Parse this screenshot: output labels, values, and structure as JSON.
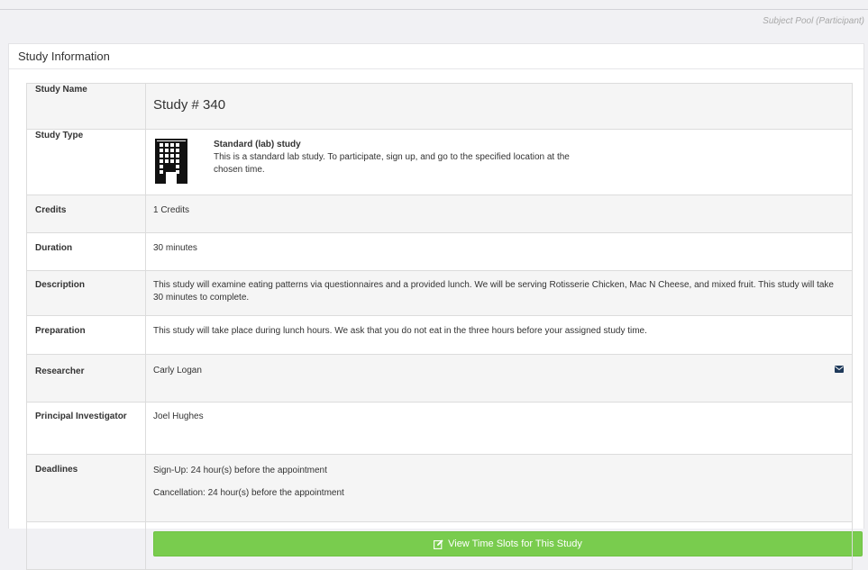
{
  "header": {
    "role_label": "Subject Pool (Participant)"
  },
  "panel": {
    "title": "Study Information"
  },
  "study": {
    "name_label": "Study Name",
    "name_value": "Study # 340",
    "type_label": "Study Type",
    "type_title": "Standard (lab) study",
    "type_description": "This is a standard lab study. To participate, sign up, and go to the specified location at the chosen time.",
    "type_icon": "building-icon",
    "credits_label": "Credits",
    "credits_value": "1 Credits",
    "duration_label": "Duration",
    "duration_value": "30 minutes",
    "description_label": "Description",
    "description_value": "This study will examine eating patterns via questionnaires and a provided lunch. We will be serving Rotisserie Chicken, Mac N Cheese, and mixed fruit. This study will take 30 minutes to complete.",
    "preparation_label": "Preparation",
    "preparation_value": "This study will take place during lunch hours. We ask that you do not eat in the three hours before your assigned study time.",
    "researcher_label": "Researcher",
    "researcher_value": "Carly Logan",
    "pi_label": "Principal Investigator",
    "pi_value": "Joel Hughes",
    "deadlines_label": "Deadlines",
    "signup_deadline": "Sign-Up:  24 hour(s) before the appointment",
    "cancel_deadline": "Cancellation:  24 hour(s) before the appointment"
  },
  "actions": {
    "view_slots_label": "View Time Slots for This Study"
  },
  "colors": {
    "accent_green": "#79cc4e",
    "border": "#dcdcdc",
    "alt_row": "#f5f5f5"
  }
}
